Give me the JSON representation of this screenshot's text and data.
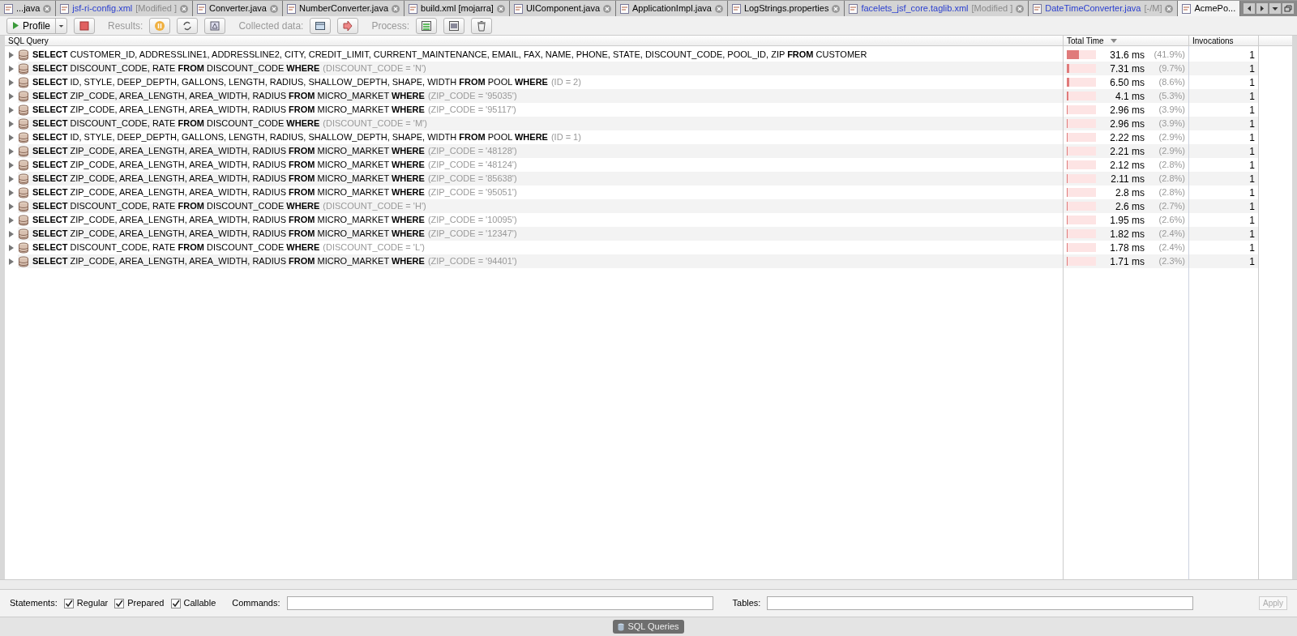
{
  "tabs": [
    {
      "label": "...java",
      "modified": false,
      "selected": false
    },
    {
      "label": "jsf-ri-config.xml",
      "note": "[Modified ]",
      "modified": true,
      "selected": false
    },
    {
      "label": "Converter.java",
      "modified": false,
      "selected": false
    },
    {
      "label": "NumberConverter.java",
      "modified": false,
      "selected": false
    },
    {
      "label": "build.xml [mojarra]",
      "modified": false,
      "selected": false
    },
    {
      "label": "UIComponent.java",
      "modified": false,
      "selected": false
    },
    {
      "label": "ApplicationImpl.java",
      "modified": false,
      "selected": false
    },
    {
      "label": "LogStrings.properties",
      "modified": false,
      "selected": false
    },
    {
      "label": "facelets_jsf_core.taglib.xml",
      "note": "[Modified ]",
      "modified": true,
      "selected": false
    },
    {
      "label": "DateTimeConverter.java",
      "note": "[-/M]",
      "modified": true,
      "selected": false
    },
    {
      "label": "AcmePo...",
      "modified": false,
      "selected": true
    }
  ],
  "toolbar": {
    "profile": "Profile",
    "results_label": "Results:",
    "collected_label": "Collected data:",
    "process_label": "Process:"
  },
  "table": {
    "columns": [
      "SQL Query",
      "Total Time",
      "Invocations"
    ],
    "rows": [
      {
        "statement": "**SELECT** CUSTOMER_ID, ADDRESSLINE1, ADDRESSLINE2, CITY, CREDIT_LIMIT, CURRENT_MAINTENANCE, EMAIL, FAX, NAME, PHONE, STATE, DISCOUNT_CODE, POOL_ID, ZIP **FROM** CUSTOMER",
        "time": "31.6 ms",
        "percent": "(41.9%)",
        "level": 0.419,
        "invocations": "1"
      },
      {
        "statement": "**SELECT** DISCOUNT_CODE, RATE **FROM** DISCOUNT_CODE **WHERE**",
        "condition": "(DISCOUNT_CODE = 'N')",
        "time": "7.31 ms",
        "percent": "(9.7%)",
        "level": 0.097,
        "invocations": "1"
      },
      {
        "statement": "**SELECT** ID, STYLE, DEEP_DEPTH, GALLONS, LENGTH, RADIUS, SHALLOW_DEPTH, SHAPE, WIDTH **FROM** POOL **WHERE**",
        "condition": "(ID = 2)",
        "time": "6.50 ms",
        "percent": "(8.6%)",
        "level": 0.086,
        "invocations": "1"
      },
      {
        "statement": "**SELECT** ZIP_CODE, AREA_LENGTH, AREA_WIDTH, RADIUS **FROM** MICRO_MARKET **WHERE**",
        "condition": "(ZIP_CODE = '95035')",
        "time": "4.1 ms",
        "percent": "(5.3%)",
        "level": 0.053,
        "invocations": "1"
      },
      {
        "statement": "**SELECT** ZIP_CODE, AREA_LENGTH, AREA_WIDTH, RADIUS **FROM** MICRO_MARKET **WHERE**",
        "condition": "(ZIP_CODE = '95117')",
        "time": "2.96 ms",
        "percent": "(3.9%)",
        "level": 0.039,
        "invocations": "1"
      },
      {
        "statement": "**SELECT** DISCOUNT_CODE, RATE **FROM** DISCOUNT_CODE **WHERE**",
        "condition": "(DISCOUNT_CODE = 'M')",
        "time": "2.96 ms",
        "percent": "(3.9%)",
        "level": 0.039,
        "invocations": "1"
      },
      {
        "statement": "**SELECT** ID, STYLE, DEEP_DEPTH, GALLONS, LENGTH, RADIUS, SHALLOW_DEPTH, SHAPE, WIDTH **FROM** POOL **WHERE**",
        "condition": "(ID = 1)",
        "time": "2.22 ms",
        "percent": "(2.9%)",
        "level": 0.029,
        "invocations": "1"
      },
      {
        "statement": "**SELECT** ZIP_CODE, AREA_LENGTH, AREA_WIDTH, RADIUS **FROM** MICRO_MARKET **WHERE**",
        "condition": "(ZIP_CODE = '48128')",
        "time": "2.21 ms",
        "percent": "(2.9%)",
        "level": 0.029,
        "invocations": "1"
      },
      {
        "statement": "**SELECT** ZIP_CODE, AREA_LENGTH, AREA_WIDTH, RADIUS **FROM** MICRO_MARKET **WHERE**",
        "condition": "(ZIP_CODE = '48124')",
        "time": "2.12 ms",
        "percent": "(2.8%)",
        "level": 0.028,
        "invocations": "1"
      },
      {
        "statement": "**SELECT** ZIP_CODE, AREA_LENGTH, AREA_WIDTH, RADIUS **FROM** MICRO_MARKET **WHERE**",
        "condition": "(ZIP_CODE = '85638')",
        "time": "2.11 ms",
        "percent": "(2.8%)",
        "level": 0.028,
        "invocations": "1"
      },
      {
        "statement": "**SELECT** ZIP_CODE, AREA_LENGTH, AREA_WIDTH, RADIUS **FROM** MICRO_MARKET **WHERE**",
        "condition": "(ZIP_CODE = '95051')",
        "time": "2.8 ms",
        "percent": "(2.8%)",
        "level": 0.028,
        "invocations": "1"
      },
      {
        "statement": "**SELECT** DISCOUNT_CODE, RATE **FROM** DISCOUNT_CODE **WHERE**",
        "condition": "(DISCOUNT_CODE = 'H')",
        "time": "2.6 ms",
        "percent": "(2.7%)",
        "level": 0.027,
        "invocations": "1"
      },
      {
        "statement": "**SELECT** ZIP_CODE, AREA_LENGTH, AREA_WIDTH, RADIUS **FROM** MICRO_MARKET **WHERE**",
        "condition": "(ZIP_CODE = '10095')",
        "time": "1.95 ms",
        "percent": "(2.6%)",
        "level": 0.026,
        "invocations": "1"
      },
      {
        "statement": "**SELECT** ZIP_CODE, AREA_LENGTH, AREA_WIDTH, RADIUS **FROM** MICRO_MARKET **WHERE**",
        "condition": "(ZIP_CODE = '12347')",
        "time": "1.82 ms",
        "percent": "(2.4%)",
        "level": 0.024,
        "invocations": "1"
      },
      {
        "statement": "**SELECT** DISCOUNT_CODE, RATE **FROM** DISCOUNT_CODE **WHERE**",
        "condition": "(DISCOUNT_CODE = 'L')",
        "time": "1.78 ms",
        "percent": "(2.4%)",
        "level": 0.024,
        "invocations": "1"
      },
      {
        "statement": "**SELECT** ZIP_CODE, AREA_LENGTH, AREA_WIDTH, RADIUS **FROM** MICRO_MARKET **WHERE**",
        "condition": "(ZIP_CODE = '94401')",
        "time": "1.71 ms",
        "percent": "(2.3%)",
        "level": 0.023,
        "invocations": "1"
      }
    ]
  },
  "filters": {
    "statements_label": "Statements:",
    "checkboxes": [
      {
        "label": "Regular",
        "checked": true
      },
      {
        "label": "Prepared",
        "checked": true
      },
      {
        "label": "Callable",
        "checked": true
      }
    ],
    "commands_label": "Commands:",
    "tables_label": "Tables:",
    "apply": "Apply"
  },
  "status_bar": {
    "button": "SQL Queries"
  }
}
